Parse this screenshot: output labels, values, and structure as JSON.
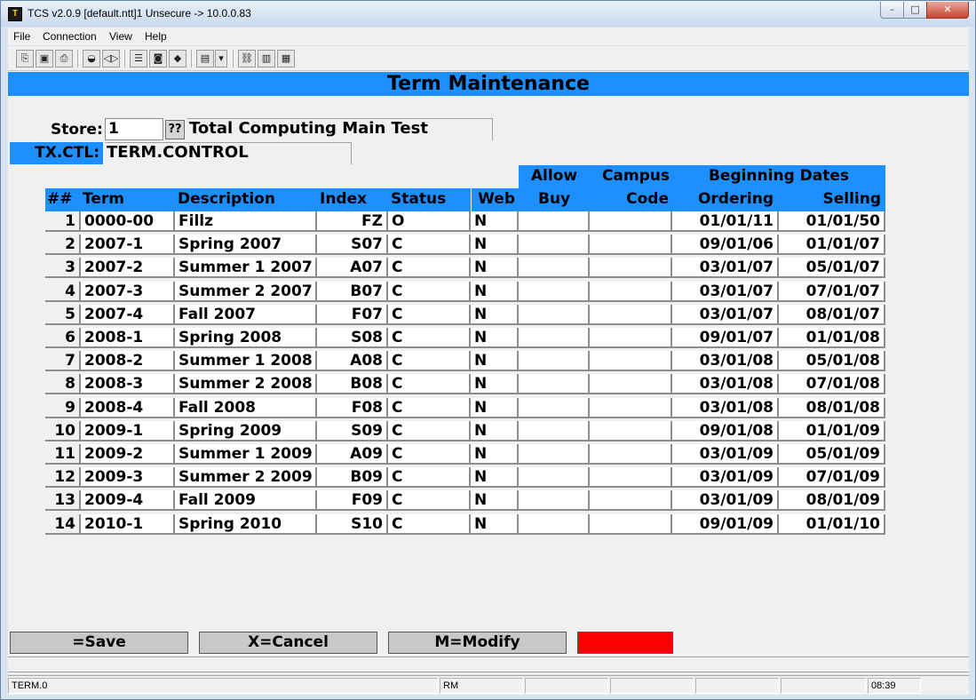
{
  "window": {
    "title": "TCS v2.0.9 [default.ntt]1 Unsecure -> 10.0.0.83",
    "app_icon": "T",
    "min_icon": "minimize-icon",
    "max_icon": "maximize-icon",
    "close_icon": "close-icon"
  },
  "menu": [
    "File",
    "Connection",
    "View",
    "Help"
  ],
  "toolbar": {
    "icons": [
      "copy-icon",
      "save-icon",
      "print-icon",
      "lock-icon",
      "sound-icon",
      "properties-icon",
      "monitor-icon",
      "book-icon",
      "screens-icon",
      "dropdown-icon",
      "network-icon",
      "chart-icon",
      "calculator-icon"
    ]
  },
  "screen": {
    "title": "Term Maintenance",
    "store_label": "Store:",
    "store_value": "1",
    "lookup_label": "??",
    "store_name": "Total Computing Main Test",
    "txctl_label": "TX.CTL:",
    "txctl_value": "TERM.CONTROL"
  },
  "grid": {
    "headers": {
      "num": "##",
      "term": "Term",
      "description": "Description",
      "index": "Index",
      "status": "Status",
      "web": "Web",
      "allow": "Allow",
      "buy": "Buy",
      "campus": "Campus",
      "code": "Code",
      "beginning_dates": "Beginning Dates",
      "ordering": "Ordering",
      "selling": "Selling"
    },
    "rows": [
      {
        "num": "1",
        "term": "0000-00",
        "description": "Fillz",
        "index": "FZ",
        "status": "O",
        "web": "N",
        "buy": "",
        "code": "",
        "ordering": "01/01/11",
        "selling": "01/01/50"
      },
      {
        "num": "2",
        "term": "2007-1",
        "description": "Spring 2007",
        "index": "S07",
        "status": "C",
        "web": "N",
        "buy": "",
        "code": "",
        "ordering": "09/01/06",
        "selling": "01/01/07"
      },
      {
        "num": "3",
        "term": "2007-2",
        "description": "Summer 1 2007",
        "index": "A07",
        "status": "C",
        "web": "N",
        "buy": "",
        "code": "",
        "ordering": "03/01/07",
        "selling": "05/01/07"
      },
      {
        "num": "4",
        "term": "2007-3",
        "description": "Summer 2 2007",
        "index": "B07",
        "status": "C",
        "web": "N",
        "buy": "",
        "code": "",
        "ordering": "03/01/07",
        "selling": "07/01/07"
      },
      {
        "num": "5",
        "term": "2007-4",
        "description": "Fall 2007",
        "index": "F07",
        "status": "C",
        "web": "N",
        "buy": "",
        "code": "",
        "ordering": "03/01/07",
        "selling": "08/01/07"
      },
      {
        "num": "6",
        "term": "2008-1",
        "description": "Spring 2008",
        "index": "S08",
        "status": "C",
        "web": "N",
        "buy": "",
        "code": "",
        "ordering": "09/01/07",
        "selling": "01/01/08"
      },
      {
        "num": "7",
        "term": "2008-2",
        "description": "Summer 1 2008",
        "index": "A08",
        "status": "C",
        "web": "N",
        "buy": "",
        "code": "",
        "ordering": "03/01/08",
        "selling": "05/01/08"
      },
      {
        "num": "8",
        "term": "2008-3",
        "description": "Summer 2 2008",
        "index": "B08",
        "status": "C",
        "web": "N",
        "buy": "",
        "code": "",
        "ordering": "03/01/08",
        "selling": "07/01/08"
      },
      {
        "num": "9",
        "term": "2008-4",
        "description": "Fall 2008",
        "index": "F08",
        "status": "C",
        "web": "N",
        "buy": "",
        "code": "",
        "ordering": "03/01/08",
        "selling": "08/01/08"
      },
      {
        "num": "10",
        "term": "2009-1",
        "description": "Spring 2009",
        "index": "S09",
        "status": "C",
        "web": "N",
        "buy": "",
        "code": "",
        "ordering": "09/01/08",
        "selling": "01/01/09"
      },
      {
        "num": "11",
        "term": "2009-2",
        "description": "Summer 1 2009",
        "index": "A09",
        "status": "C",
        "web": "N",
        "buy": "",
        "code": "",
        "ordering": "03/01/09",
        "selling": "05/01/09"
      },
      {
        "num": "12",
        "term": "2009-3",
        "description": "Summer 2 2009",
        "index": "B09",
        "status": "C",
        "web": "N",
        "buy": "",
        "code": "",
        "ordering": "03/01/09",
        "selling": "07/01/09"
      },
      {
        "num": "13",
        "term": "2009-4",
        "description": "Fall 2009",
        "index": "F09",
        "status": "C",
        "web": "N",
        "buy": "",
        "code": "",
        "ordering": "03/01/09",
        "selling": "08/01/09"
      },
      {
        "num": "14",
        "term": "2010-1",
        "description": "Spring 2010",
        "index": "S10",
        "status": "C",
        "web": "N",
        "buy": "",
        "code": "",
        "ordering": "09/01/09",
        "selling": "01/01/10"
      }
    ]
  },
  "buttons": {
    "save": "=Save",
    "cancel": "X=Cancel",
    "modify": "M=Modify",
    "indicator": ""
  },
  "status": {
    "screen": "TERM.0",
    "mode": "RM",
    "p3": "",
    "p4": "",
    "p5": "",
    "p6": "",
    "time": "08:39"
  },
  "colors": {
    "header_blue": "#1e8fff",
    "indicator_red": "#ff0000"
  }
}
